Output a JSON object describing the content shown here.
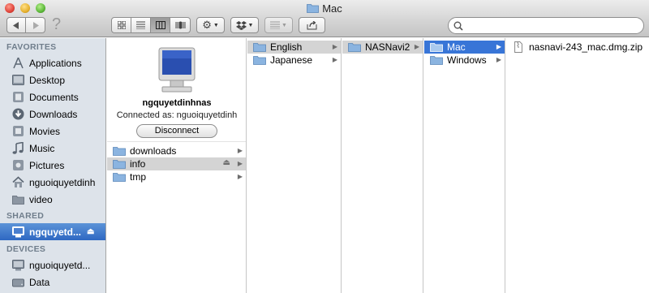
{
  "window": {
    "title": "Mac"
  },
  "toolbar": {
    "back_icon": "back-arrow-icon",
    "forward_icon": "forward-arrow-icon",
    "help_glyph": "?",
    "view_buttons": [
      "icon-view",
      "list-view",
      "column-view",
      "cover-flow-view"
    ],
    "active_view": "column-view",
    "search": {
      "value": "",
      "placeholder": ""
    }
  },
  "sidebar": {
    "favorites_header": "FAVORITES",
    "favorites": [
      {
        "label": "Applications",
        "icon": "applications-icon"
      },
      {
        "label": "Desktop",
        "icon": "desktop-icon"
      },
      {
        "label": "Documents",
        "icon": "documents-icon"
      },
      {
        "label": "Downloads",
        "icon": "downloads-icon"
      },
      {
        "label": "Movies",
        "icon": "movies-icon"
      },
      {
        "label": "Music",
        "icon": "music-icon"
      },
      {
        "label": "Pictures",
        "icon": "pictures-icon"
      },
      {
        "label": "nguoiquyetdinh",
        "icon": "home-icon"
      },
      {
        "label": "video",
        "icon": "folder-icon"
      }
    ],
    "shared_header": "SHARED",
    "shared": [
      {
        "label": "ngquyetd...",
        "icon": "server-icon",
        "selected": true,
        "eject": "⏏"
      }
    ],
    "devices_header": "DEVICES",
    "devices": [
      {
        "label": "nguoiquyetd...",
        "icon": "computer-icon"
      },
      {
        "label": "Data",
        "icon": "disk-icon"
      }
    ]
  },
  "server": {
    "name": "ngquyetdinhnas",
    "connected_as": "Connected as: nguoiquyetdinh",
    "disconnect_label": "Disconnect"
  },
  "columns": {
    "col1": [
      {
        "label": "downloads",
        "selected": ""
      },
      {
        "label": "info",
        "selected": "gray",
        "eject": "⏏"
      },
      {
        "label": "tmp",
        "selected": ""
      }
    ],
    "col2": [
      {
        "label": "English",
        "selected": "gray"
      },
      {
        "label": "Japanese",
        "selected": ""
      }
    ],
    "col3": [
      {
        "label": "NASNavi2",
        "selected": "gray"
      }
    ],
    "col4": [
      {
        "label": "Mac",
        "selected": "blue"
      },
      {
        "label": "Windows",
        "selected": ""
      }
    ],
    "col5": [
      {
        "label": "nasnavi-243_mac.dmg.zip",
        "selected": ""
      }
    ]
  },
  "colors": {
    "selection_blue": "#3875d7",
    "sidebar_bg": "#dde3ea",
    "folder_blue": "#8bb4e0"
  }
}
